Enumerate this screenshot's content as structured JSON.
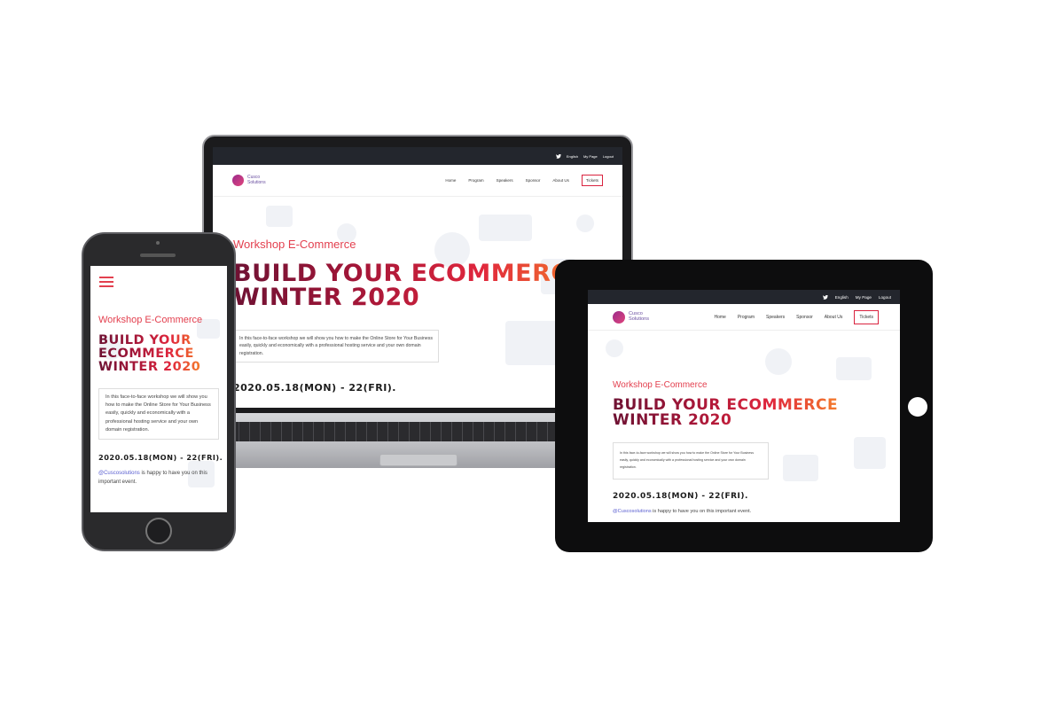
{
  "site": {
    "topbar": {
      "twitter_icon": "twitter-icon",
      "language": "English",
      "my_page": "My Page",
      "logout": "Logout"
    },
    "logo": {
      "line1": "Cusco",
      "line2": "Solutions"
    },
    "nav": [
      "Home",
      "Program",
      "Speakers",
      "Sponsor",
      "About Us"
    ],
    "tickets_label": "Tickets",
    "eyebrow": "Workshop E-Commerce",
    "headline_line1": "BUILD YOUR ECOMMERCE",
    "headline_line2": "WINTER 2020",
    "phone_headline": [
      "BUILD YOUR",
      "ECOMMERCE",
      "WINTER 2020"
    ],
    "intro": "In this face-to-face workshop we will show you how to make the Online Store for Your Business easily, quickly and economically with a professional hosting service and your own domain registration.",
    "dates": "2020.05.18(MON) - 22(FRI).",
    "note_handle": "@Cuscosolutions",
    "note_middle": " is happy to have you on ",
    "note_link": "this important event",
    "note_end": "."
  },
  "menu_icon": "hamburger-menu-icon",
  "colors": {
    "accent": "#e3404f",
    "headline_dark": "#6e1233",
    "headline_light": "#f47b2b",
    "topbar": "#23262d",
    "link": "#5a5fd0"
  }
}
